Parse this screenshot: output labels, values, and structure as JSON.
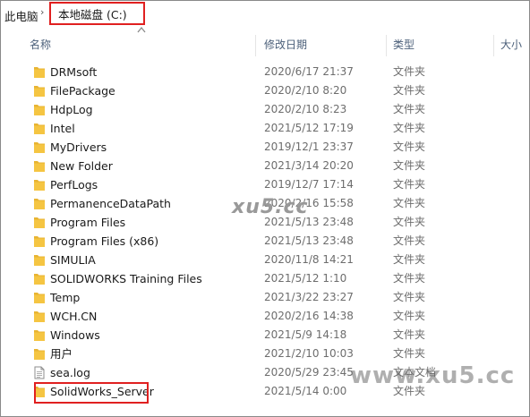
{
  "breadcrumb": {
    "root": "此电脑",
    "separator": "›",
    "current": "本地磁盘 (C:)",
    "highlight_color": "#e02020"
  },
  "columns": {
    "name": "名称",
    "date": "修改日期",
    "type": "类型",
    "size": "大小"
  },
  "sort": {
    "column": "name",
    "direction": "ascending"
  },
  "files": [
    {
      "name": "DRMsoft",
      "date": "2020/6/17 21:37",
      "type": "文件夹",
      "icon": "folder-icon"
    },
    {
      "name": "FilePackage",
      "date": "2020/2/10 8:20",
      "type": "文件夹",
      "icon": "folder-icon"
    },
    {
      "name": "HdpLog",
      "date": "2020/2/10 8:23",
      "type": "文件夹",
      "icon": "folder-icon"
    },
    {
      "name": "Intel",
      "date": "2021/5/12 17:19",
      "type": "文件夹",
      "icon": "folder-icon"
    },
    {
      "name": "MyDrivers",
      "date": "2019/12/1 23:37",
      "type": "文件夹",
      "icon": "folder-icon"
    },
    {
      "name": "New Folder",
      "date": "2021/3/14 20:20",
      "type": "文件夹",
      "icon": "folder-icon"
    },
    {
      "name": "PerfLogs",
      "date": "2019/12/7 17:14",
      "type": "文件夹",
      "icon": "folder-icon"
    },
    {
      "name": "PermanenceDataPath",
      "date": "2020/2/16 15:58",
      "type": "文件夹",
      "icon": "folder-icon"
    },
    {
      "name": "Program Files",
      "date": "2021/5/13 23:48",
      "type": "文件夹",
      "icon": "folder-icon"
    },
    {
      "name": "Program Files (x86)",
      "date": "2021/5/13 23:48",
      "type": "文件夹",
      "icon": "folder-icon"
    },
    {
      "name": "SIMULIA",
      "date": "2020/11/8 14:21",
      "type": "文件夹",
      "icon": "folder-icon"
    },
    {
      "name": "SOLIDWORKS Training Files",
      "date": "2021/5/12 1:10",
      "type": "文件夹",
      "icon": "folder-icon"
    },
    {
      "name": "Temp",
      "date": "2021/3/22 23:27",
      "type": "文件夹",
      "icon": "folder-icon"
    },
    {
      "name": "WCH.CN",
      "date": "2020/2/16 14:38",
      "type": "文件夹",
      "icon": "folder-icon"
    },
    {
      "name": "Windows",
      "date": "2021/5/9 14:18",
      "type": "文件夹",
      "icon": "folder-icon"
    },
    {
      "name": "用户",
      "date": "2021/2/10 10:03",
      "type": "文件夹",
      "icon": "folder-icon"
    },
    {
      "name": "sea.log",
      "date": "2020/5/29 23:45",
      "type": "文本文档",
      "icon": "text-file-icon"
    },
    {
      "name": "SolidWorks_Server",
      "date": "2021/5/14 0:00",
      "type": "文件夹",
      "icon": "folder-icon",
      "highlighted": true
    }
  ],
  "watermark": {
    "middle": "xu5.cc",
    "bottom": "www.xu5.cc"
  },
  "colors": {
    "folder": "#f5c542",
    "header_text": "#4c607a",
    "secondary_text": "#6d6d6d"
  }
}
